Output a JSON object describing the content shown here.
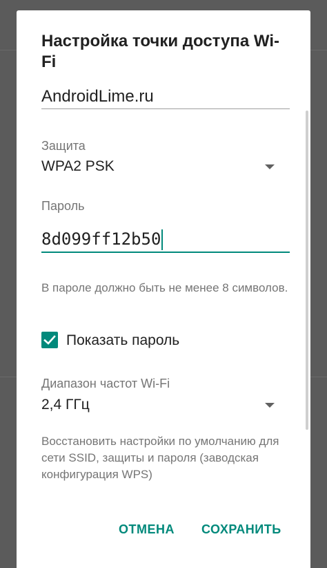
{
  "dialog": {
    "title": "Настройка точки доступа Wi-Fi",
    "ssid": {
      "value": "AndroidLime.ru"
    },
    "security": {
      "label": "Защита",
      "value": "WPA2 PSK"
    },
    "password": {
      "label": "Пароль",
      "value": "8d099ff12b50"
    },
    "hint": "В пароле должно быть не менее 8 символов.",
    "show_password": {
      "label": "Показать пароль",
      "checked": true
    },
    "band": {
      "label": "Диапазон частот Wi-Fi",
      "value": "2,4 ГГц"
    },
    "wps_text": "Восстановить настройки по умолчанию для сети SSID, защиты и пароля (заводская конфигурация WPS)",
    "buttons": {
      "cancel": "ОТМЕНА",
      "save": "СОХРАНИТЬ"
    }
  },
  "colors": {
    "accent": "#00897b",
    "scrim": "#5b5b5b"
  }
}
